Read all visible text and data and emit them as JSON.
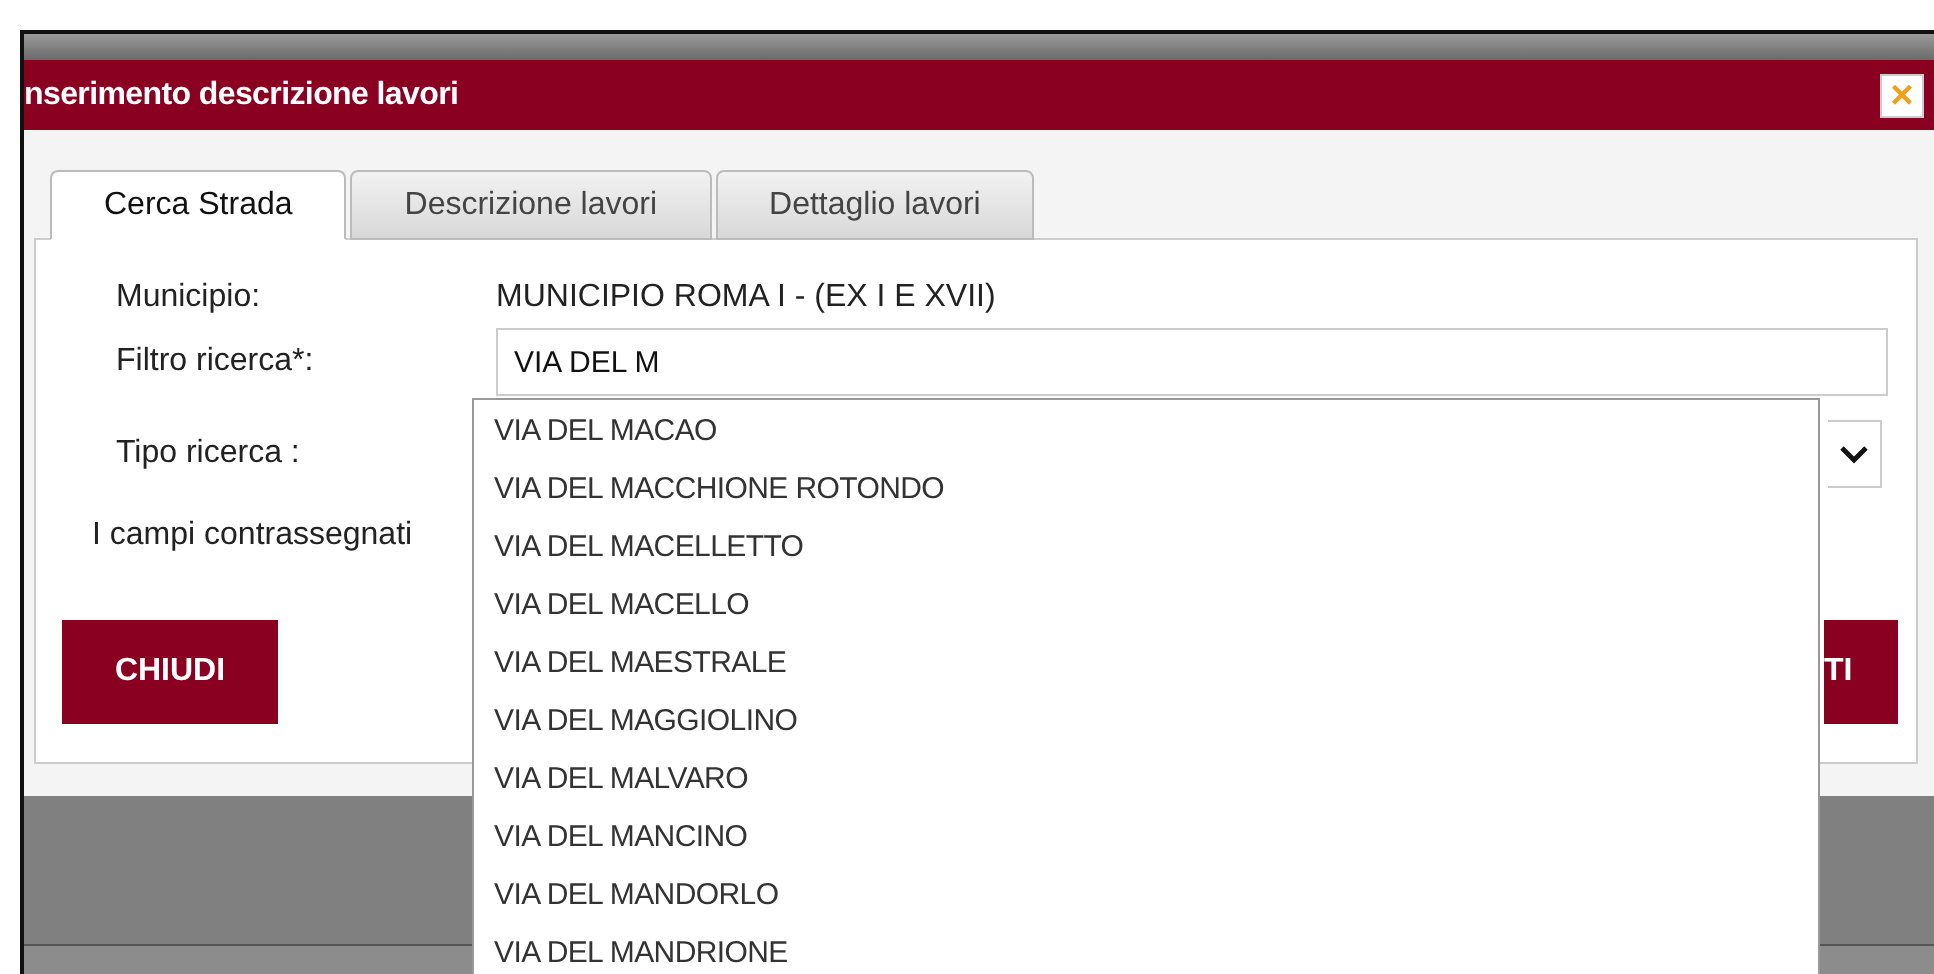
{
  "dialog": {
    "title": "nserimento descrizione lavori",
    "close": "×"
  },
  "tabs": [
    {
      "label": "Cerca Strada",
      "selected": true
    },
    {
      "label": "Descrizione lavori",
      "selected": false
    },
    {
      "label": "Dettaglio lavori",
      "selected": false
    }
  ],
  "form": {
    "municipio_label": "Municipio:",
    "municipio_value": "MUNICIPIO ROMA I - (EX I E XVII)",
    "filtro_label": "Filtro ricerca*:",
    "filtro_value": "VIA DEL M",
    "tipo_label": "Tipo ricerca :",
    "note": "I campi contrassegnati"
  },
  "buttons": [
    {
      "label": "CHIUDI"
    },
    {
      "label": "TI"
    }
  ],
  "suggestions": [
    "VIA DEL MACAO",
    "VIA DEL MACCHIONE ROTONDO",
    "VIA DEL MACELLETTO",
    "VIA DEL MACELLO",
    "VIA DEL MAESTRALE",
    "VIA DEL MAGGIOLINO",
    "VIA DEL MALVARO",
    "VIA DEL MANCINO",
    "VIA DEL MANDORLO",
    "VIA DEL MANDRIONE"
  ]
}
